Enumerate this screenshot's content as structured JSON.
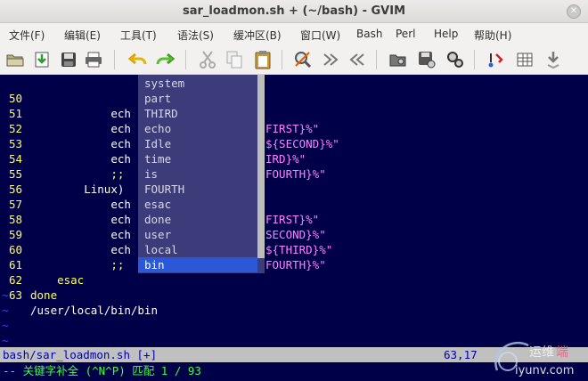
{
  "window": {
    "title": "sar_loadmon.sh + (~/bash) - GVIM"
  },
  "menu": [
    {
      "label": "文件(F)"
    },
    {
      "label": "编辑(E)"
    },
    {
      "label": "工具(T)"
    },
    {
      "label": "语法(S)"
    },
    {
      "label": "缓冲区(B)"
    },
    {
      "label": "窗口(W)"
    },
    {
      "label": "Bash"
    },
    {
      "label": "Perl"
    },
    {
      "label": "Help"
    },
    {
      "label": "帮助(H)"
    }
  ],
  "toolbar": [
    {
      "icon": "open-folder-icon"
    },
    {
      "icon": "load-file-icon"
    },
    {
      "icon": "save-icon"
    },
    {
      "icon": "print-icon"
    },
    {
      "icon": "undo-icon"
    },
    {
      "icon": "redo-icon"
    },
    {
      "icon": "cut-icon"
    },
    {
      "icon": "copy-icon"
    },
    {
      "icon": "paste-icon"
    },
    {
      "icon": "find-replace-icon"
    },
    {
      "icon": "find-next-icon"
    },
    {
      "icon": "find-prev-icon"
    },
    {
      "icon": "load-session-icon"
    },
    {
      "icon": "save-session-icon"
    },
    {
      "icon": "run-script-icon"
    },
    {
      "icon": "make-icon"
    },
    {
      "icon": "build-tags-icon"
    },
    {
      "icon": "jump-tag-icon"
    }
  ],
  "lines": [
    {
      "num": "50",
      "indent": "            ",
      "text": "ech",
      "tail": "FIRST}%\""
    },
    {
      "num": "51",
      "indent": "            ",
      "text": "ech",
      "tail": "${SECOND}%\""
    },
    {
      "num": "52",
      "indent": "            ",
      "text": "ech",
      "tail": "IRD}%\""
    },
    {
      "num": "53",
      "indent": "            ",
      "text": "ech",
      "tail": "FOURTH}%\""
    },
    {
      "num": "54",
      "indent": "            ",
      "text": ";;",
      "tail": ""
    },
    {
      "num": "55",
      "indent": "        ",
      "text": "Linux)",
      "tail": ""
    },
    {
      "num": "56",
      "indent": "            ",
      "text": "ech",
      "tail": "FIRST}%\""
    },
    {
      "num": "57",
      "indent": "            ",
      "text": "ech",
      "tail": "SECOND}%\""
    },
    {
      "num": "58",
      "indent": "            ",
      "text": "ech",
      "tail": "${THIRD}%\""
    },
    {
      "num": "59",
      "indent": "            ",
      "text": "ech",
      "tail": "FOURTH}%\""
    },
    {
      "num": "60",
      "indent": "            ",
      "text": ";;",
      "tail": ""
    },
    {
      "num": "61",
      "indent": "    ",
      "text": "esac",
      "tail": ""
    },
    {
      "num": "62",
      "indent": "",
      "text": "done",
      "tail": ""
    },
    {
      "num": "63",
      "indent": "",
      "text": "/user/local/bin/bin",
      "tail": ""
    }
  ],
  "tilde": "~",
  "popup": {
    "items": [
      "system",
      "part",
      "THIRD",
      "echo",
      "Idle",
      "time",
      "is",
      "FOURTH",
      "esac",
      "done",
      "user",
      "local",
      "bin"
    ],
    "selected_index": 12
  },
  "status": {
    "file": "bash/sar_loadmon.sh [+]",
    "position": "63,17"
  },
  "cmdline": {
    "message": "-- 关键字补全 (^N^P) 匹配 1 / 93"
  },
  "watermark": {
    "text1": "运维",
    "text2": "iyunv.com"
  },
  "colors": {
    "editor_bg": "#000048",
    "line_number": "#ffff60",
    "string": "#ff80ff",
    "popup_bg": "#3c3c7a",
    "popup_selected": "#2a58d8",
    "status_bg": "#c0c0c0",
    "cmd_text": "#40ff40"
  }
}
